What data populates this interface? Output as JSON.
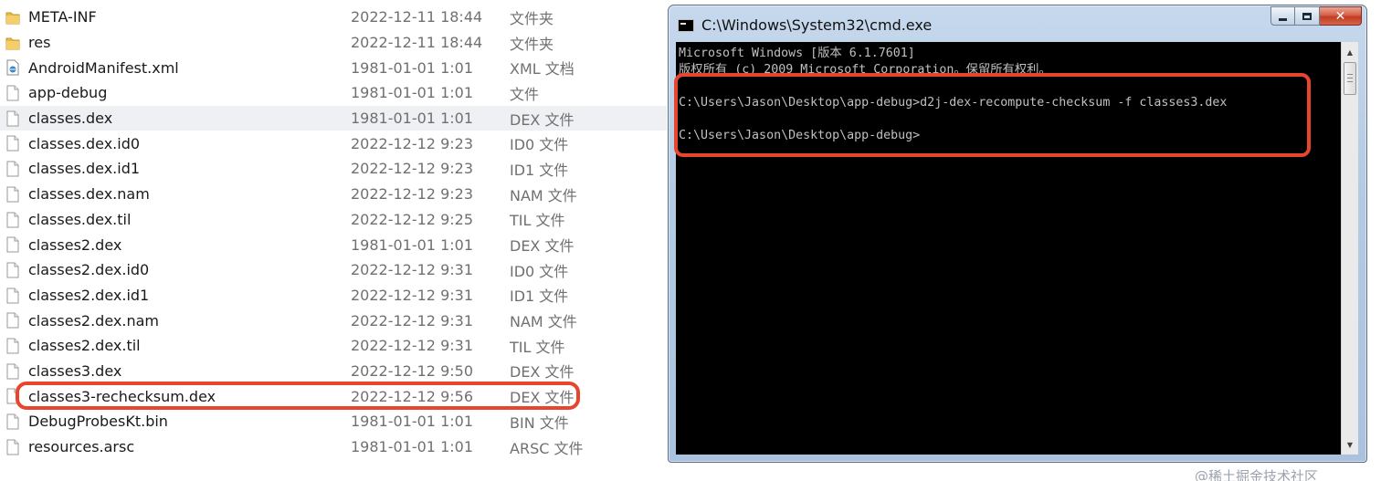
{
  "files": [
    {
      "icon": "folder-icon",
      "name": "META-INF",
      "date": "2022-12-11 18:44",
      "type": "文件夹",
      "selected": false
    },
    {
      "icon": "folder-icon",
      "name": "res",
      "date": "2022-12-11 18:44",
      "type": "文件夹",
      "selected": false
    },
    {
      "icon": "xml-file-icon",
      "name": "AndroidManifest.xml",
      "date": "1981-01-01 1:01",
      "type": "XML 文档",
      "selected": false
    },
    {
      "icon": "file-icon",
      "name": "app-debug",
      "date": "1981-01-01 1:01",
      "type": "文件",
      "selected": false
    },
    {
      "icon": "file-icon",
      "name": "classes.dex",
      "date": "1981-01-01 1:01",
      "type": "DEX 文件",
      "selected": true
    },
    {
      "icon": "file-icon",
      "name": "classes.dex.id0",
      "date": "2022-12-12 9:23",
      "type": "ID0 文件",
      "selected": false
    },
    {
      "icon": "file-icon",
      "name": "classes.dex.id1",
      "date": "2022-12-12 9:23",
      "type": "ID1 文件",
      "selected": false
    },
    {
      "icon": "file-icon",
      "name": "classes.dex.nam",
      "date": "2022-12-12 9:23",
      "type": "NAM 文件",
      "selected": false
    },
    {
      "icon": "file-icon",
      "name": "classes.dex.til",
      "date": "2022-12-12 9:25",
      "type": "TIL 文件",
      "selected": false
    },
    {
      "icon": "file-icon",
      "name": "classes2.dex",
      "date": "1981-01-01 1:01",
      "type": "DEX 文件",
      "selected": false
    },
    {
      "icon": "file-icon",
      "name": "classes2.dex.id0",
      "date": "2022-12-12 9:31",
      "type": "ID0 文件",
      "selected": false
    },
    {
      "icon": "file-icon",
      "name": "classes2.dex.id1",
      "date": "2022-12-12 9:31",
      "type": "ID1 文件",
      "selected": false
    },
    {
      "icon": "file-icon",
      "name": "classes2.dex.nam",
      "date": "2022-12-12 9:31",
      "type": "NAM 文件",
      "selected": false
    },
    {
      "icon": "file-icon",
      "name": "classes2.dex.til",
      "date": "2022-12-12 9:31",
      "type": "TIL 文件",
      "selected": false
    },
    {
      "icon": "file-icon",
      "name": "classes3.dex",
      "date": "2022-12-12 9:50",
      "type": "DEX 文件",
      "selected": false
    },
    {
      "icon": "file-icon",
      "name": "classes3-rechecksum.dex",
      "date": "2022-12-12 9:56",
      "type": "DEX 文件",
      "selected": false
    },
    {
      "icon": "file-icon",
      "name": "DebugProbesKt.bin",
      "date": "1981-01-01 1:01",
      "type": "BIN 文件",
      "selected": false
    },
    {
      "icon": "file-icon",
      "name": "resources.arsc",
      "date": "1981-01-01 1:01",
      "type": "ARSC 文件",
      "selected": false
    }
  ],
  "cmd": {
    "title": "C:\\Windows\\System32\\cmd.exe",
    "lines": [
      "Microsoft Windows [版本 6.1.7601]",
      "版权所有 (c) 2009 Microsoft Corporation。保留所有权利。",
      "",
      "C:\\Users\\Jason\\Desktop\\app-debug>d2j-dex-recompute-checksum -f classes3.dex",
      "",
      "C:\\Users\\Jason\\Desktop\\app-debug>"
    ]
  },
  "watermark": "@稀土掘金技术社区",
  "colors": {
    "highlight": "#e8452e",
    "folder": "#e8b84a",
    "console_bg": "#000000",
    "console_fg": "#c0c0c0",
    "selected_row": "#eef0f3"
  }
}
